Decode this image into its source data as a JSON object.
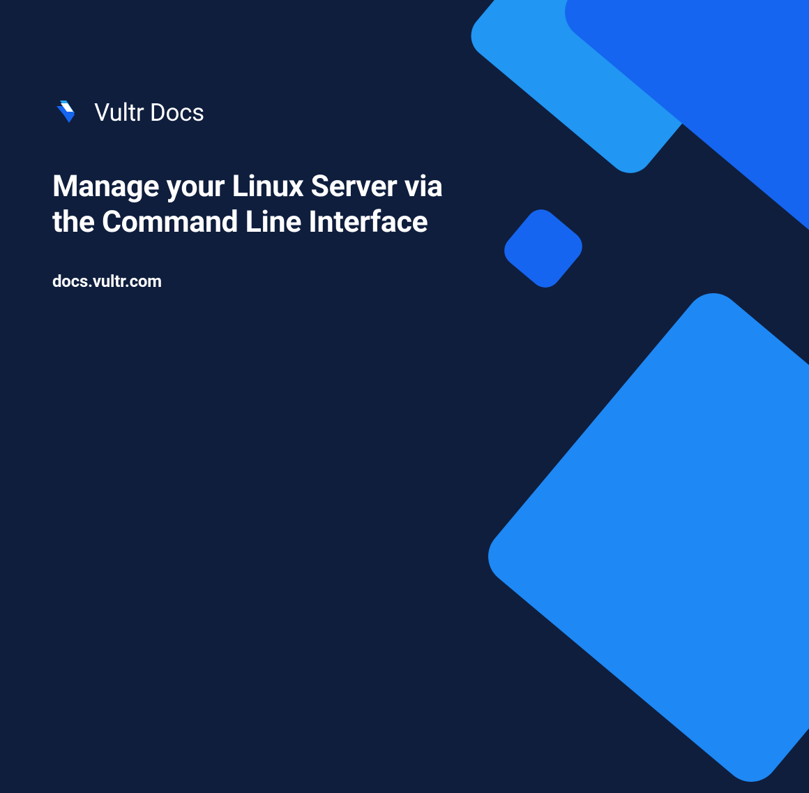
{
  "brand": {
    "name": "Vultr Docs"
  },
  "page": {
    "title": "Manage your Linux Server via the Command Line Interface",
    "url": "docs.vultr.com"
  }
}
